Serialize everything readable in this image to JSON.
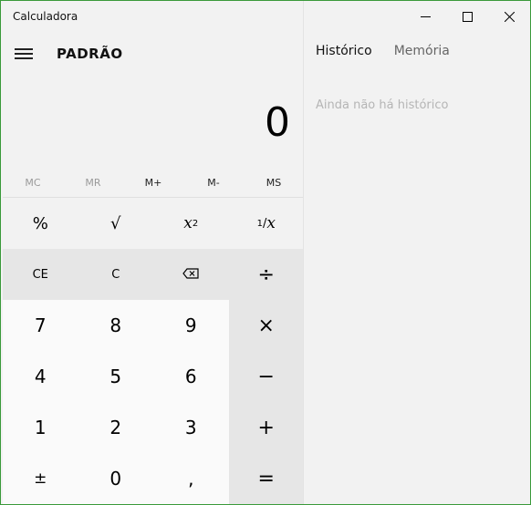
{
  "window": {
    "title": "Calculadora",
    "border_color": "#3a9a3a",
    "controls": [
      "minimize-icon",
      "maximize-icon",
      "close-icon"
    ]
  },
  "header": {
    "menu_icon": "hamburger-menu-icon",
    "mode": "PADRÃO"
  },
  "display": {
    "value": "0"
  },
  "memory": {
    "buttons": [
      {
        "label": "MC",
        "enabled": false
      },
      {
        "label": "MR",
        "enabled": false
      },
      {
        "label": "M+",
        "enabled": true
      },
      {
        "label": "M-",
        "enabled": true
      },
      {
        "label": "MS",
        "enabled": true
      }
    ]
  },
  "keys": {
    "percent": "%",
    "sqrt": "√",
    "square_base": "x",
    "square_exp": "2",
    "reciprocal_num": "1",
    "reciprocal_den": "x",
    "ce": "CE",
    "c": "C",
    "backspace": "⌫",
    "divide": "÷",
    "seven": "7",
    "eight": "8",
    "nine": "9",
    "multiply": "×",
    "four": "4",
    "five": "5",
    "six": "6",
    "minus": "−",
    "one": "1",
    "two": "2",
    "three": "3",
    "plus": "+",
    "negate": "±",
    "zero": "0",
    "decimal": ",",
    "equals": "="
  },
  "side_panel": {
    "tabs": [
      {
        "label": "Histórico",
        "active": true
      },
      {
        "label": "Memória",
        "active": false
      }
    ],
    "empty_message": "Ainda não há histórico"
  }
}
